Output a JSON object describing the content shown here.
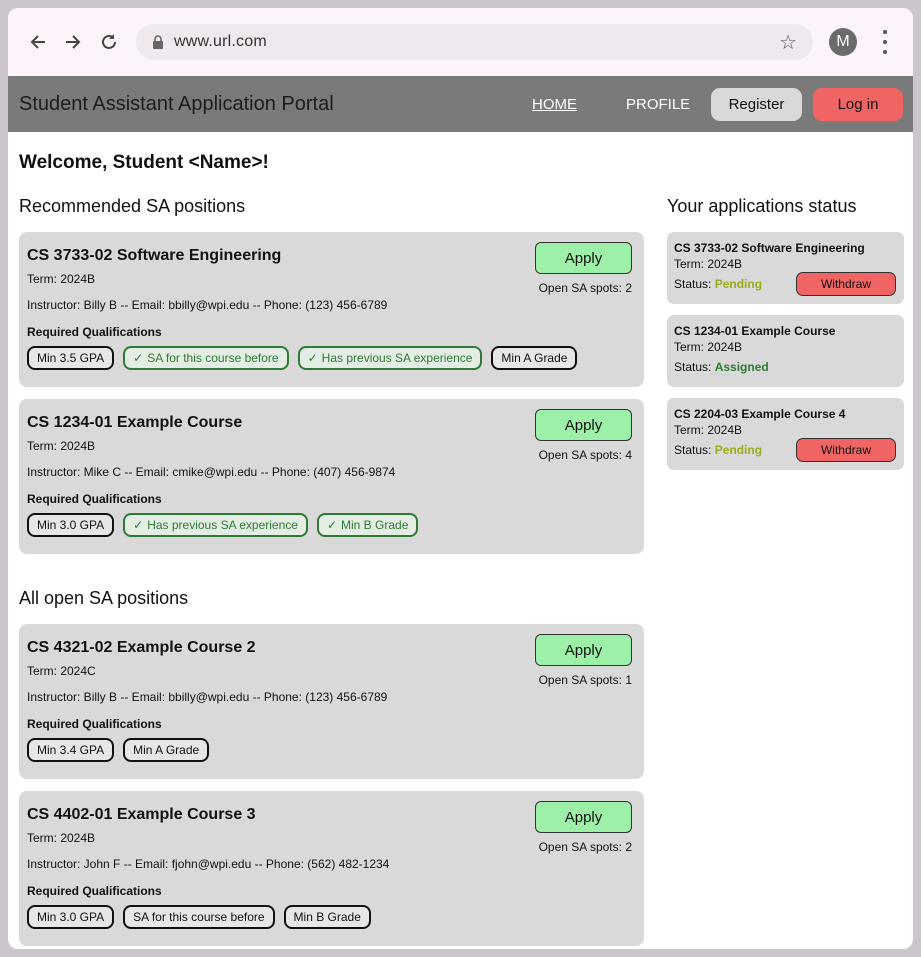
{
  "browser": {
    "url": "www.url.com",
    "profile_initial": "M"
  },
  "nav": {
    "brand": "Student Assistant Application Portal",
    "home": "HOME",
    "profile": "PROFILE",
    "register": "Register",
    "login": "Log in"
  },
  "welcome": "Welcome, Student <Name>!",
  "recommended": {
    "title": "Recommended SA positions",
    "cards": [
      {
        "title": "CS 3733-02 Software Engineering",
        "term": "Term: 2024B",
        "contact": "Instructor: Billy B  --  Email: bbilly@wpi.edu  --  Phone: (123) 456-6789",
        "req_label": "Required Qualifications",
        "apply": "Apply",
        "spots": "Open SA spots: 2",
        "quals": [
          {
            "text": "Min 3.5 GPA",
            "met": false
          },
          {
            "text": "SA for this course before",
            "met": true
          },
          {
            "text": "Has previous SA experience",
            "met": true
          },
          {
            "text": "Min A Grade",
            "met": false
          }
        ]
      },
      {
        "title": "CS 1234-01 Example Course",
        "term": "Term: 2024B",
        "contact": "Instructor: Mike C  --  Email: cmike@wpi.edu  --  Phone: (407) 456-9874",
        "req_label": "Required Qualifications",
        "apply": "Apply",
        "spots": "Open SA spots: 4",
        "quals": [
          {
            "text": "Min 3.0 GPA",
            "met": false
          },
          {
            "text": "Has previous SA experience",
            "met": true
          },
          {
            "text": "Min B Grade",
            "met": true
          }
        ]
      }
    ]
  },
  "all_open": {
    "title": "All open SA positions",
    "cards": [
      {
        "title": "CS 4321-02 Example Course 2",
        "term": "Term: 2024C",
        "contact": "Instructor: Billy B  --  Email: bbilly@wpi.edu  --  Phone: (123) 456-6789",
        "req_label": "Required Qualifications",
        "apply": "Apply",
        "spots": "Open SA spots: 1",
        "quals": [
          {
            "text": "Min 3.4 GPA",
            "met": false
          },
          {
            "text": "Min A Grade",
            "met": false
          }
        ]
      },
      {
        "title": "CS 4402-01 Example Course 3",
        "term": "Term: 2024B",
        "contact": "Instructor: John F  --  Email: fjohn@wpi.edu  --  Phone: (562) 482-1234",
        "req_label": "Required Qualifications",
        "apply": "Apply",
        "spots": "Open SA spots: 2",
        "quals": [
          {
            "text": "Min 3.0 GPA",
            "met": false
          },
          {
            "text": "SA for this course before",
            "met": false
          },
          {
            "text": "Min B Grade",
            "met": false
          }
        ]
      }
    ]
  },
  "status": {
    "title": "Your applications status",
    "status_label": "Status:",
    "withdraw": "Withdraw",
    "items": [
      {
        "title": "CS 3733-02 Software Engineering",
        "term": "Term: 2024B",
        "status": "Pending"
      },
      {
        "title": "CS 1234-01 Example Course",
        "term": "Term: 2024B",
        "status": "Assigned"
      },
      {
        "title": "CS 2204-03 Example Course 4",
        "term": "Term: 2024B",
        "status": "Pending"
      }
    ]
  },
  "colors": {
    "pending": "#9aac18",
    "assigned": "#2f7a34",
    "apply": "#9df0a8",
    "danger": "#f06464"
  }
}
